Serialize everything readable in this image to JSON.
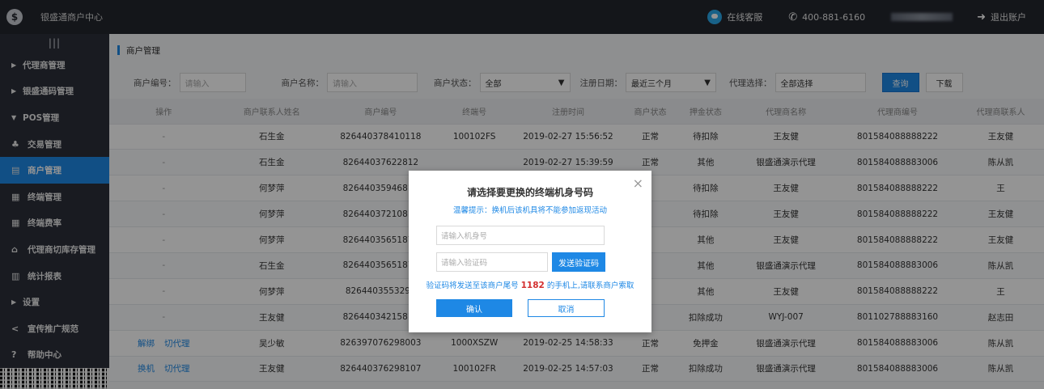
{
  "header": {
    "app_title": "银盛通商户中心",
    "online_service": "在线客服",
    "phone": "400-881-6160",
    "logout": "退出账户"
  },
  "sidebar": {
    "toggle": "|||",
    "items": [
      {
        "label": "代理商管理",
        "type": "group",
        "expanded": false
      },
      {
        "label": "银盛通码管理",
        "type": "group",
        "expanded": false
      },
      {
        "label": "POS管理",
        "type": "group",
        "expanded": true
      },
      {
        "label": "交易管理",
        "type": "sub",
        "icon": "transaction-icon"
      },
      {
        "label": "商户管理",
        "type": "sub",
        "icon": "merchant-icon",
        "active": true
      },
      {
        "label": "终端管理",
        "type": "sub",
        "icon": "terminal-icon"
      },
      {
        "label": "终端费率",
        "type": "sub",
        "icon": "rate-icon"
      },
      {
        "label": "代理商切库存管理",
        "type": "sub",
        "icon": "stock-icon"
      },
      {
        "label": "统计报表",
        "type": "sub",
        "icon": "report-icon"
      },
      {
        "label": "设置",
        "type": "group",
        "expanded": false
      },
      {
        "label": "宣传推广规范",
        "type": "link",
        "icon": "share-icon"
      },
      {
        "label": "帮助中心",
        "type": "link",
        "icon": "help-icon"
      }
    ]
  },
  "breadcrumb": "商户管理",
  "filters": {
    "merchant_no_label": "商户编号：",
    "merchant_no_placeholder": "请输入",
    "merchant_name_label": "商户名称：",
    "merchant_name_placeholder": "请输入",
    "status_label": "商户状态：",
    "status_value": "全部",
    "reg_date_label": "注册日期：",
    "reg_date_value": "最近三个月",
    "agent_label": "代理选择：",
    "agent_value": "全部选择",
    "query_button": "查询",
    "download_button": "下载"
  },
  "table": {
    "columns": [
      "操作",
      "商户联系人姓名",
      "商户编号",
      "终端号",
      "注册时间",
      "商户状态",
      "押金状态",
      "代理商名称",
      "代理商编号",
      "代理商联系人"
    ],
    "rows": [
      {
        "ops": [
          "-"
        ],
        "contact": "石生金",
        "merchant_no": "826440378410118",
        "terminal": "100102FS",
        "reg_time": "2019-02-27 15:56:52",
        "status": "正常",
        "deposit": "待扣除",
        "agent_name": "王友健",
        "agent_no": "801584088888222",
        "agent_contact": "王友健"
      },
      {
        "ops": [
          "-"
        ],
        "contact": "石生金",
        "merchant_no": "82644037622812",
        "terminal": "",
        "reg_time": "2019-02-27 15:39:59",
        "status": "正常",
        "deposit": "其他",
        "agent_name": "银盛通演示代理",
        "agent_no": "801584088883006",
        "agent_contact": "陈从凯"
      },
      {
        "ops": [
          "-"
        ],
        "contact": "何梦萍",
        "merchant_no": "82644035946818",
        "terminal": "",
        "reg_time": "",
        "status": "",
        "deposit": "待扣除",
        "agent_name": "王友健",
        "agent_no": "801584088888222",
        "agent_contact": "王"
      },
      {
        "ops": [
          "-"
        ],
        "contact": "何梦萍",
        "merchant_no": "82644037210818",
        "terminal": "",
        "reg_time": "",
        "status": "",
        "deposit": "待扣除",
        "agent_name": "王友健",
        "agent_no": "801584088888222",
        "agent_contact": "王友健"
      },
      {
        "ops": [
          "-"
        ],
        "contact": "何梦萍",
        "merchant_no": "82644035651878",
        "terminal": "",
        "reg_time": "",
        "status": "",
        "deposit": "其他",
        "agent_name": "王友健",
        "agent_no": "801584088888222",
        "agent_contact": "王友健"
      },
      {
        "ops": [
          "-"
        ],
        "contact": "石生金",
        "merchant_no": "82644035651878",
        "terminal": "",
        "reg_time": "",
        "status": "",
        "deposit": "其他",
        "agent_name": "银盛通演示代理",
        "agent_no": "801584088883006",
        "agent_contact": "陈从凯"
      },
      {
        "ops": [
          "-"
        ],
        "contact": "何梦萍",
        "merchant_no": "826440355329K",
        "terminal": "",
        "reg_time": "",
        "status": "",
        "deposit": "其他",
        "agent_name": "王友健",
        "agent_no": "801584088888222",
        "agent_contact": "王"
      },
      {
        "ops": [
          "-"
        ],
        "contact": "王友健",
        "merchant_no": "82644034215818",
        "terminal": "",
        "reg_time": "",
        "status": "",
        "deposit": "扣除成功",
        "agent_name": "WYJ-007",
        "agent_no": "801102788883160",
        "agent_contact": "赵志田"
      },
      {
        "ops": [
          "解绑",
          "切代理"
        ],
        "contact": "吴少敏",
        "merchant_no": "826397076298003",
        "terminal": "1000XSZW",
        "reg_time": "2019-02-25 14:58:33",
        "status": "正常",
        "deposit": "免押金",
        "agent_name": "银盛通演示代理",
        "agent_no": "801584088883006",
        "agent_contact": "陈从凯"
      },
      {
        "ops": [
          "换机",
          "切代理"
        ],
        "contact": "王友健",
        "merchant_no": "826440376298107",
        "terminal": "100102FR",
        "reg_time": "2019-02-25 14:57:03",
        "status": "正常",
        "deposit": "扣除成功",
        "agent_name": "银盛通演示代理",
        "agent_no": "801584088883006",
        "agent_contact": "陈从凯"
      }
    ]
  },
  "modal": {
    "close": "×",
    "title": "请选择要更换的终端机身号码",
    "tip": "温馨提示：换机后该机具将不能参加返现活动",
    "sn_placeholder": "请输入机身号",
    "code_placeholder": "请输入验证码",
    "send_code_button": "发送验证码",
    "hint_prefix": "验证码将发送至该商户尾号",
    "hint_number": "1182",
    "hint_suffix": "的手机上,请联系商户索取",
    "confirm_button": "确认",
    "cancel_button": "取消"
  }
}
